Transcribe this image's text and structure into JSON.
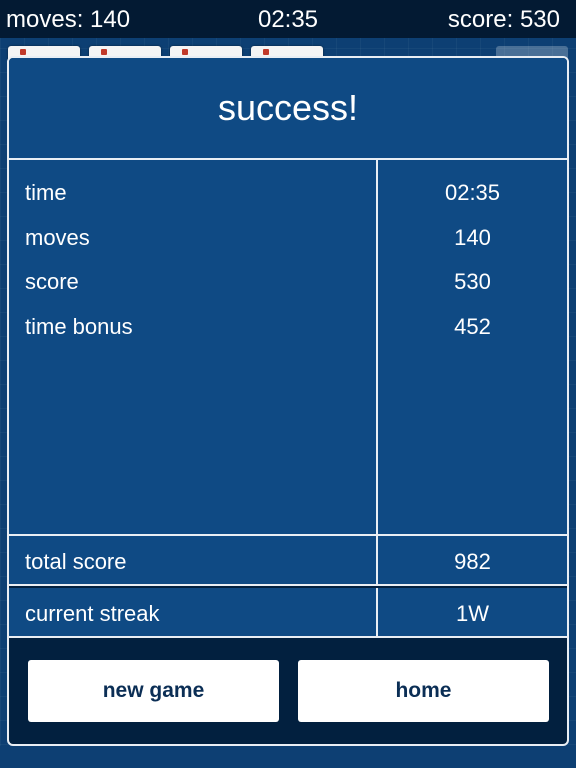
{
  "status_bar": {
    "moves": "moves: 140",
    "time": "02:35",
    "score": "score: 530"
  },
  "dialog": {
    "title": "success!",
    "stats": [
      {
        "label": "time",
        "value": "02:35"
      },
      {
        "label": "moves",
        "value": "140"
      },
      {
        "label": "score",
        "value": "530"
      },
      {
        "label": "time bonus",
        "value": "452"
      }
    ],
    "total_score": {
      "label": "total score",
      "value": "982"
    },
    "current_streak": {
      "label": "current streak",
      "value": "1W"
    },
    "buttons": {
      "new_game": "new game",
      "home": "home"
    }
  },
  "colors": {
    "panel_blue": "#0f4a84",
    "dark_navy": "#02203f",
    "border": "#e9eef4",
    "button_text": "#0b2e55"
  }
}
